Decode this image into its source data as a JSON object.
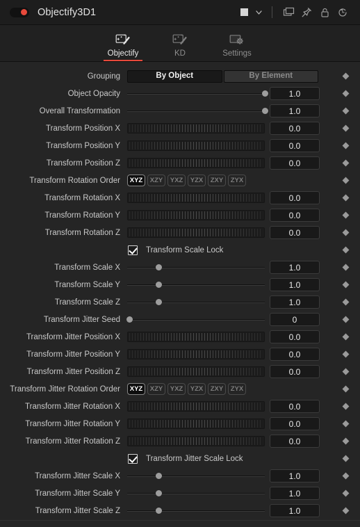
{
  "titlebar": {
    "node_name": "Objectify3D1",
    "power_toggle": "enabled",
    "color_swatch": "#d6d6d6",
    "icons": [
      "color-swatch",
      "chevron-down",
      "duplicate",
      "pin",
      "lock",
      "reset-history"
    ]
  },
  "tabs": [
    {
      "label": "Objectify",
      "icon": "magic-wand-image-icon",
      "active": true
    },
    {
      "label": "KD",
      "icon": "magic-wand-image-icon",
      "active": false
    },
    {
      "label": "Settings",
      "icon": "gear-image-icon",
      "active": false
    }
  ],
  "accent_color": "#e8493b",
  "rotation_order_options": [
    "XYZ",
    "XZY",
    "YXZ",
    "YZX",
    "ZXY",
    "ZYX"
  ],
  "controls": [
    {
      "label": "Grouping",
      "type": "segmented",
      "options": [
        "By Object",
        "By Element"
      ],
      "selected": "By Object",
      "keyframe": true
    },
    {
      "label": "Object Opacity",
      "type": "slider",
      "value": "1.0",
      "pos": 100,
      "keyframe": true
    },
    {
      "label": "Overall Transformation",
      "type": "slider",
      "value": "1.0",
      "pos": 100,
      "keyframe": true
    },
    {
      "label": "Transform Position X",
      "type": "wheel",
      "value": "0.0",
      "keyframe": true
    },
    {
      "label": "Transform Position Y",
      "type": "wheel",
      "value": "0.0",
      "keyframe": true
    },
    {
      "label": "Transform Position Z",
      "type": "wheel",
      "value": "0.0",
      "keyframe": true
    },
    {
      "label": "Transform Rotation Order",
      "type": "order",
      "selected": "XYZ",
      "keyframe": true
    },
    {
      "label": "Transform Rotation X",
      "type": "wheel",
      "value": "0.0",
      "keyframe": true
    },
    {
      "label": "Transform Rotation Y",
      "type": "wheel",
      "value": "0.0",
      "keyframe": true
    },
    {
      "label": "Transform Rotation Z",
      "type": "wheel",
      "value": "0.0",
      "keyframe": true
    },
    {
      "label": "Transform Scale Lock",
      "type": "checkbox",
      "checked": true,
      "keyframe": true
    },
    {
      "label": "Transform Scale X",
      "type": "slider",
      "value": "1.0",
      "pos": 23,
      "keyframe": true
    },
    {
      "label": "Transform Scale Y",
      "type": "slider",
      "value": "1.0",
      "pos": 23,
      "keyframe": true
    },
    {
      "label": "Transform Scale Z",
      "type": "slider",
      "value": "1.0",
      "pos": 23,
      "keyframe": true
    },
    {
      "label": "Transform Jitter Seed",
      "type": "slider",
      "value": "0",
      "pos": 2,
      "keyframe": true
    },
    {
      "label": "Transform Jitter Position X",
      "type": "wheel",
      "value": "0.0",
      "keyframe": true
    },
    {
      "label": "Transform Jitter Position Y",
      "type": "wheel",
      "value": "0.0",
      "keyframe": true
    },
    {
      "label": "Transform Jitter Position Z",
      "type": "wheel",
      "value": "0.0",
      "keyframe": true
    },
    {
      "label": "Transform Jitter Rotation Order",
      "type": "order",
      "selected": "XYZ",
      "keyframe": true
    },
    {
      "label": "Transform Jitter Rotation X",
      "type": "wheel",
      "value": "0.0",
      "keyframe": true
    },
    {
      "label": "Transform Jitter Rotation Y",
      "type": "wheel",
      "value": "0.0",
      "keyframe": true
    },
    {
      "label": "Transform Jitter Rotation Z",
      "type": "wheel",
      "value": "0.0",
      "keyframe": true
    },
    {
      "label": "Transform Jitter Scale Lock",
      "type": "checkbox",
      "checked": true,
      "keyframe": true
    },
    {
      "label": "Transform Jitter Scale X",
      "type": "slider",
      "value": "1.0",
      "pos": 23,
      "keyframe": true
    },
    {
      "label": "Transform Jitter Scale Y",
      "type": "slider",
      "value": "1.0",
      "pos": 23,
      "keyframe": true
    },
    {
      "label": "Transform Jitter Scale Z",
      "type": "slider",
      "value": "1.0",
      "pos": 23,
      "keyframe": true
    }
  ]
}
